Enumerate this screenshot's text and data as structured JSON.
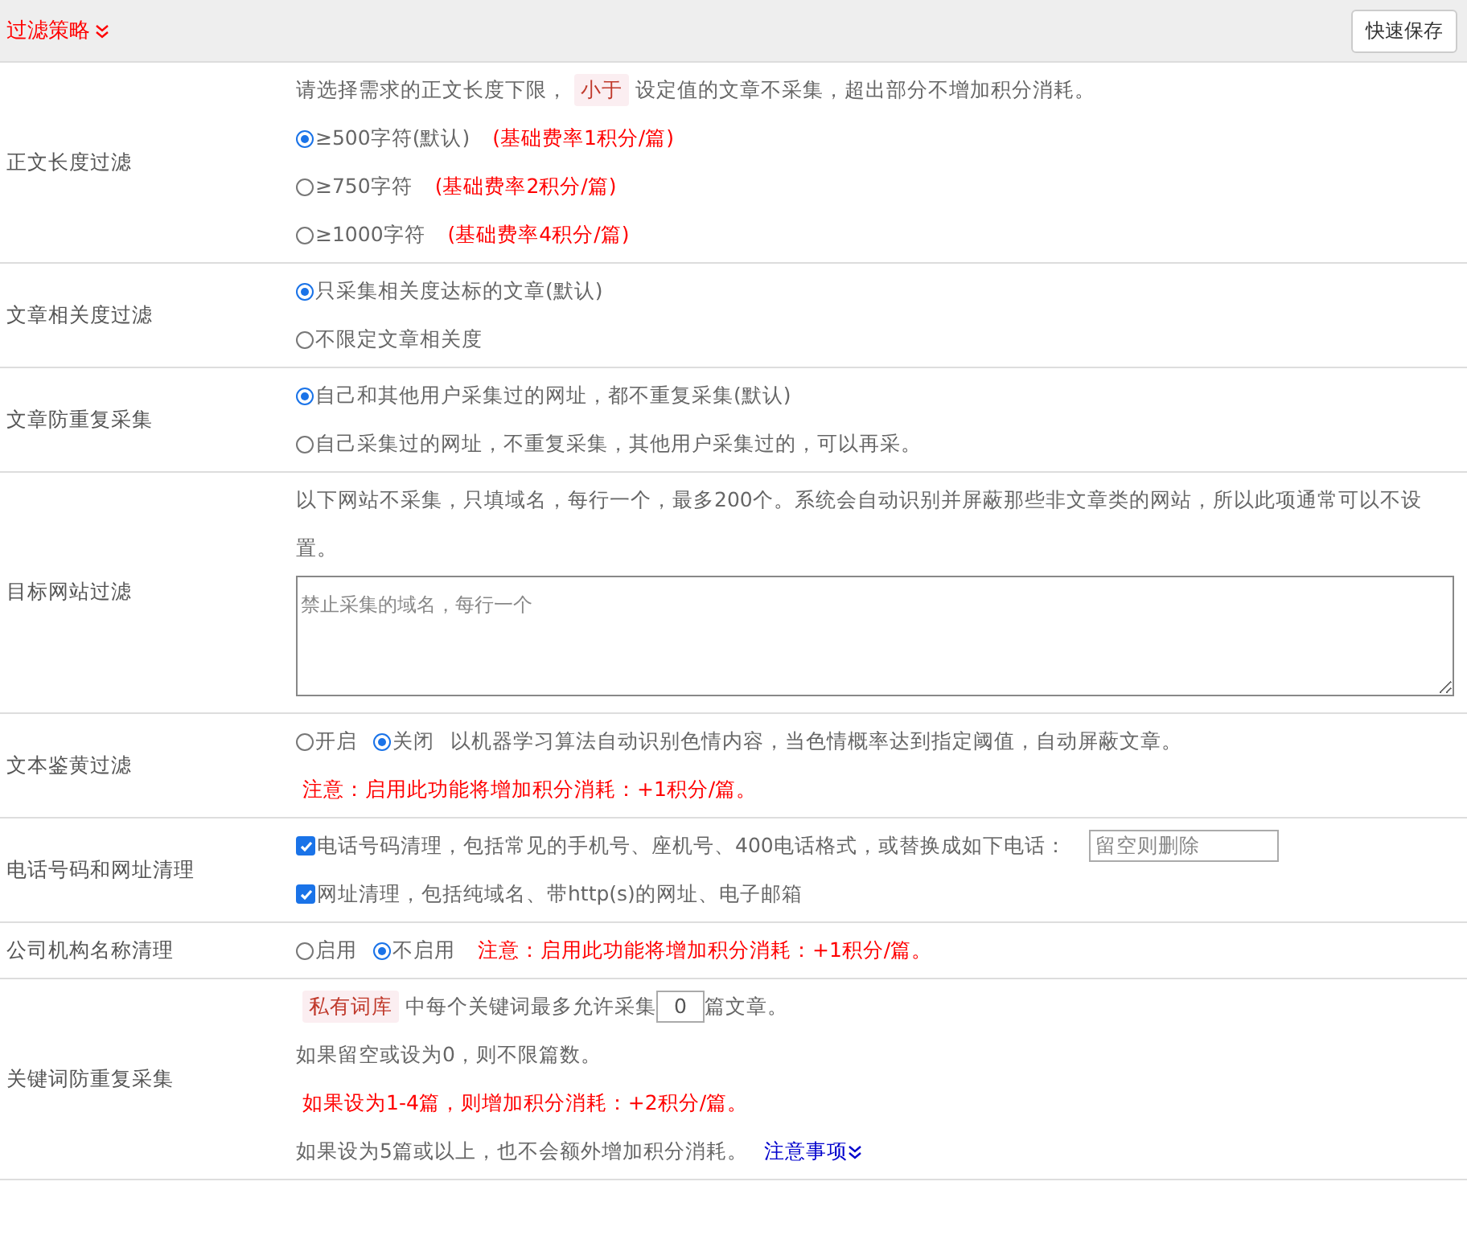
{
  "header": {
    "title": "过滤策略",
    "save_button": "快速保存"
  },
  "sections": [
    {
      "label": "正文长度过滤",
      "lines": [
        {
          "segments": [
            {
              "kind": "text",
              "text": "请选择需求的正文长度下限，"
            },
            {
              "kind": "tag",
              "text": "小于"
            },
            {
              "kind": "text",
              "text": "设定值的文章不采集，超出部分不增加积分消耗。"
            }
          ]
        },
        {
          "segments": [
            {
              "kind": "radio",
              "label": "≥500字符(默认)",
              "selected": true
            },
            {
              "kind": "warning",
              "text": "(基础费率1积分/篇)"
            }
          ]
        },
        {
          "segments": [
            {
              "kind": "radio",
              "label": "≥750字符",
              "selected": false
            },
            {
              "kind": "warning",
              "text": "(基础费率2积分/篇)"
            }
          ]
        },
        {
          "segments": [
            {
              "kind": "radio",
              "label": "≥1000字符",
              "selected": false
            },
            {
              "kind": "warning",
              "text": "(基础费率4积分/篇)"
            }
          ]
        }
      ]
    },
    {
      "label": "文章相关度过滤",
      "lines": [
        {
          "segments": [
            {
              "kind": "radio",
              "label": "只采集相关度达标的文章(默认)",
              "selected": true
            }
          ]
        },
        {
          "segments": [
            {
              "kind": "radio",
              "label": "不限定文章相关度",
              "selected": false
            }
          ]
        }
      ]
    },
    {
      "label": "文章防重复采集",
      "lines": [
        {
          "segments": [
            {
              "kind": "radio",
              "label": "自己和其他用户采集过的网址，都不重复采集(默认)",
              "selected": true
            }
          ]
        },
        {
          "segments": [
            {
              "kind": "radio",
              "label": "自己采集过的网址，不重复采集，其他用户采集过的，可以再采。",
              "selected": false
            }
          ]
        }
      ]
    },
    {
      "label": "目标网站过滤",
      "lines": [
        {
          "segments": [
            {
              "kind": "text",
              "text": "以下网站不采集，只填域名，每行一个，最多200个。系统会自动识别并屏蔽那些非文章类的网站，所以此项通常可以不设置。"
            }
          ]
        },
        {
          "segments": [
            {
              "kind": "textarea",
              "placeholder": "禁止采集的域名，每行一个"
            }
          ]
        }
      ]
    },
    {
      "label": "文本鉴黄过滤",
      "lines": [
        {
          "segments": [
            {
              "kind": "radio",
              "label": "开启",
              "selected": false
            },
            {
              "kind": "radio",
              "label": "关闭",
              "selected": true
            },
            {
              "kind": "text",
              "text": "以机器学习算法自动识别色情内容，当色情概率达到指定阈值，自动屏蔽文章。"
            }
          ]
        },
        {
          "segments": [
            {
              "kind": "warning",
              "text": "注意：启用此功能将增加积分消耗：+1积分/篇。"
            }
          ]
        }
      ]
    },
    {
      "label": "电话号码和网址清理",
      "lines": [
        {
          "segments": [
            {
              "kind": "checkbox",
              "label": "电话号码清理，包括常见的手机号、座机号、400电话格式，或替换成如下电话：",
              "checked": true
            },
            {
              "kind": "input",
              "placeholder": "留空则删除"
            }
          ]
        },
        {
          "segments": [
            {
              "kind": "checkbox",
              "label": "网址清理，包括纯域名、带http(s)的网址、电子邮箱",
              "checked": true
            }
          ]
        }
      ]
    },
    {
      "label": "公司机构名称清理",
      "lines": [
        {
          "segments": [
            {
              "kind": "radio",
              "label": "启用",
              "selected": false
            },
            {
              "kind": "radio",
              "label": "不启用",
              "selected": true
            },
            {
              "kind": "warning",
              "text": "注意：启用此功能将增加积分消耗：+1积分/篇。"
            }
          ]
        }
      ]
    },
    {
      "label": "关键词防重复采集",
      "lines": [
        {
          "segments": [
            {
              "kind": "tag",
              "text": "私有词库"
            },
            {
              "kind": "text",
              "text": "中每个关键词最多允许采集"
            },
            {
              "kind": "number",
              "value": "0"
            },
            {
              "kind": "text",
              "text": "篇文章。"
            }
          ]
        },
        {
          "segments": [
            {
              "kind": "text",
              "text": "如果留空或设为0，则不限篇数。"
            }
          ]
        },
        {
          "segments": [
            {
              "kind": "warning",
              "text": "如果设为1-4篇，则增加积分消耗：+2积分/篇。"
            }
          ]
        },
        {
          "segments": [
            {
              "kind": "text",
              "text": "如果设为5篇或以上，也不会额外增加积分消耗。"
            },
            {
              "kind": "link",
              "text": "注意事项"
            }
          ]
        }
      ]
    }
  ]
}
